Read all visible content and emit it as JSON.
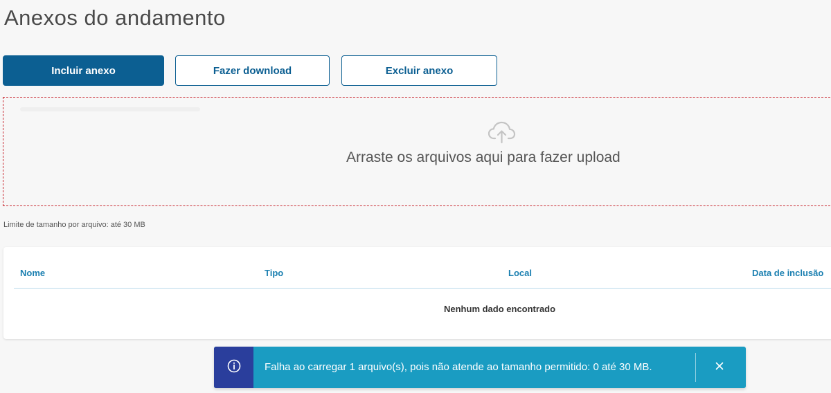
{
  "page": {
    "title": "Anexos do andamento"
  },
  "toolbar": {
    "include_label": "Incluir anexo",
    "download_label": "Fazer download",
    "delete_label": "Excluir anexo"
  },
  "dropzone": {
    "text": "Arraste os arquivos aqui para fazer upload",
    "icon": "cloud-upload-icon",
    "border_color": "#c8262f"
  },
  "limit": {
    "text": "Limite de tamanho por arquivo: até 30 MB"
  },
  "table": {
    "columns": [
      "Nome",
      "Tipo",
      "Local",
      "Data de inclusão"
    ],
    "empty_message": "Nenhum dado encontrado"
  },
  "toast": {
    "icon": "info-icon",
    "message": "Falha ao carregar 1 arquivo(s), pois não atende ao tamanho permitido: 0 até 30 MB.",
    "close_icon": "close-icon",
    "background": "#1a9cc2",
    "icon_background": "#2a3e9c"
  },
  "colors": {
    "primary": "#0c5f92",
    "header_text": "#1a7fb0"
  }
}
